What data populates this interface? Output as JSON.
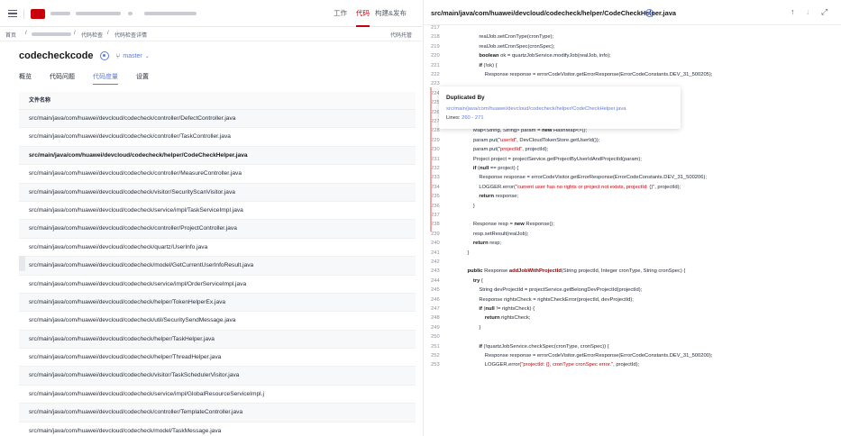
{
  "topbar": {
    "nav": [
      {
        "label": "工作",
        "active": false
      },
      {
        "label": "代码",
        "active": true
      },
      {
        "label": "构建&发布",
        "active": false
      }
    ]
  },
  "breadcrumb": {
    "home": "首页",
    "sep1": "/",
    "sep2": "/",
    "item1": "代码检查",
    "sep3": "/",
    "item2": "代码检查详情",
    "right": "代码托管"
  },
  "repo": {
    "name": "codecheckcode",
    "branch": "master",
    "branch_chevron": "⌄"
  },
  "tabs": [
    {
      "label": "概览",
      "active": false
    },
    {
      "label": "代码问题",
      "active": false
    },
    {
      "label": "代码度量",
      "active": true
    },
    {
      "label": "设置",
      "active": false
    }
  ],
  "file_table": {
    "header": "文件名称",
    "rows": [
      "src/main/java/com/huawei/devcloud/codecheck/controller/DefectController.java",
      "src/main/java/com/huawei/devcloud/codecheck/controller/TaskController.java",
      "src/main/java/com/huawei/devcloud/codecheck/helper/CodeCheckHelper.java",
      "src/main/java/com/huawei/devcloud/codecheck/controller/MeasureController.java",
      "src/main/java/com/huawei/devcloud/codecheck/visitor/SecurityScanVisitor.java",
      "src/main/java/com/huawei/devcloud/codecheck/service/impl/TaskServiceImpl.java",
      "src/main/java/com/huawei/devcloud/codecheck/controller/ProjectController.java",
      "src/main/java/com/huawei/devcloud/codecheck/quartz/UserInfo.java",
      "src/main/java/com/huawei/devcloud/codecheck/model/GetCurrentUserInfoResult.java",
      "src/main/java/com/huawei/devcloud/codecheck/service/impl/OrderServiceImpl.java",
      "src/main/java/com/huawei/devcloud/codecheck/helper/TokenHelperEx.java",
      "src/main/java/com/huawei/devcloud/codecheck/util/SecuritySendMessage.java",
      "src/main/java/com/huawei/devcloud/codecheck/helper/TaskHelper.java",
      "src/main/java/com/huawei/devcloud/codecheck/helper/ThreadHelper.java",
      "src/main/java/com/huawei/devcloud/codecheck/visitor/TaskSchedulerVisitor.java",
      "src/main/java/com/huawei/devcloud/codecheck/service/impl/GlobalResourceServiceImpl.j",
      "src/main/java/com/huawei/devcloud/codecheck/controller/TemplateController.java",
      "src/main/java/com/huawei/devcloud/codecheck/model/TaskMessage.java"
    ],
    "active_index": 2
  },
  "code_view": {
    "file_path": "src/main/java/com/huawei/devcloud/codecheck/helper/CodeCheckHelper.java",
    "icons": [
      "arrow-up-icon",
      "arrow-down-icon",
      "expand-icon"
    ],
    "icon_glyphs": {
      "up": "↑",
      "down": "↓",
      "expand": "⤢"
    },
    "lines": [
      {
        "n": "217",
        "t": ""
      },
      {
        "n": "218",
        "t": "            realJob.setCronType(cronType);"
      },
      {
        "n": "219",
        "t": "            realJob.setCronSpec(cronSpec);"
      },
      {
        "n": "220",
        "t": "            boolean ok = quartzJobService.modifyJob(realJob, info);"
      },
      {
        "n": "221",
        "t": "            if (!ok) {"
      },
      {
        "n": "222",
        "t": "                Response response = errorCodeVisitor.getErrorResponse(ErrorCodeConstants.DEV_31_500205);"
      },
      {
        "n": "223",
        "t": ""
      },
      {
        "n": "224",
        "t": ""
      },
      {
        "n": "225",
        "t": ""
      },
      {
        "n": "226",
        "t": ""
      },
      {
        "n": "227",
        "t": ""
      },
      {
        "n": "228",
        "t": "        Map<String, String> param = new HashMap<>();"
      },
      {
        "n": "229",
        "t": "        param.put(\"userId\", DevCloudTokenStore.getUserId());"
      },
      {
        "n": "230",
        "t": "        param.put(\"projectId\", projectId);"
      },
      {
        "n": "231",
        "t": "        Project project = projectService.getProjectByUserIdAndProjectId(param);"
      },
      {
        "n": "232",
        "t": "        if (null == project) {"
      },
      {
        "n": "233",
        "t": "            Response response = errorCodeVisitor.getErrorResponse(ErrorCodeConstants.DEV_31_500206);"
      },
      {
        "n": "234",
        "t": "            LOGGER.error(\"current user has no rights or project not exists, projectId: {}\", projectId);"
      },
      {
        "n": "235",
        "t": "            return response;"
      },
      {
        "n": "236",
        "t": "        }"
      },
      {
        "n": "237",
        "t": ""
      },
      {
        "n": "238",
        "t": "        Response resp = new Response();"
      },
      {
        "n": "239",
        "t": "        resp.setResult(realJob);"
      },
      {
        "n": "240",
        "t": "        return resp;"
      },
      {
        "n": "241",
        "t": "    }"
      },
      {
        "n": "242",
        "t": ""
      },
      {
        "n": "243",
        "t": "    public Response addJobWithProjectId(String projectId, Integer cronType, String cronSpec) {"
      },
      {
        "n": "244",
        "t": "        try {"
      },
      {
        "n": "245",
        "t": "            String devProjectId = projectService.getBelongDevProjectId(projectId);"
      },
      {
        "n": "246",
        "t": "            Response rightsCheck = rightsCheckError(projectId, devProjectId);"
      },
      {
        "n": "247",
        "t": "            if (null != rightsCheck) {"
      },
      {
        "n": "248",
        "t": "                return rightsCheck;"
      },
      {
        "n": "249",
        "t": "            }"
      },
      {
        "n": "250",
        "t": ""
      },
      {
        "n": "251",
        "t": "            if (!quartzJobService.checkSpec(cronType, cronSpec)) {"
      },
      {
        "n": "252",
        "t": "                Response response = errorCodeVisitor.getErrorResponse(ErrorCodeConstants.DEV_31_500200);"
      },
      {
        "n": "253",
        "t": "                LOGGER.error(\"projectId: {}, cronType cronSpec error.\", projectId);"
      }
    ]
  },
  "duplicate_popup": {
    "title": "Duplicated By",
    "link": "src/main/java/com/huawei/devcloud/codecheck/helper/CodeCheckHelper.java",
    "lines_label": "Lines:",
    "lines_range": "260 - 271"
  },
  "colors": {
    "brand_red": "#c7000b",
    "link_blue": "#5e7ce0",
    "dup_marker": "#f2a5a5"
  }
}
